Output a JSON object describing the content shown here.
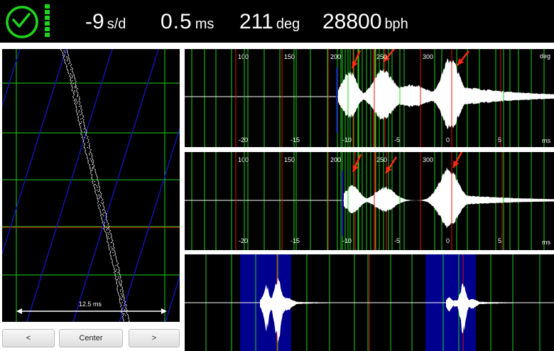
{
  "readouts": {
    "rate": {
      "value": "-9",
      "unit": "s/d"
    },
    "beat_error": {
      "value": "0.5",
      "unit": "ms"
    },
    "amplitude": {
      "value": "211",
      "unit": "deg"
    },
    "beat_rate": {
      "value": "28800",
      "unit": "bph"
    }
  },
  "colors": {
    "grid": "#1ed51e",
    "marker": "#e01010",
    "trace_line": "#1515c8",
    "highlight": "#00008f",
    "arrow": "#ff2a10"
  },
  "icons": {
    "logo": "clock-icon",
    "indicator": "signal-indicator-icon"
  },
  "timegrapher": {
    "scale_label": "12.5 ms"
  },
  "scope_top": {
    "deg_ticks": [
      {
        "v": 100,
        "t": "100"
      },
      {
        "v": 150,
        "t": "150"
      },
      {
        "v": 200,
        "t": "200"
      },
      {
        "v": 250,
        "t": "250"
      },
      {
        "v": 300,
        "t": "300"
      }
    ],
    "ms_ticks": [
      {
        "v": -20,
        "t": "-20"
      },
      {
        "v": -15,
        "t": "-15"
      },
      {
        "v": -10,
        "t": "-10"
      },
      {
        "v": -5,
        "t": "-5"
      },
      {
        "v": 0,
        "t": "0"
      },
      {
        "v": 5,
        "t": "5"
      }
    ],
    "deg_unit": "deg",
    "ms_unit": "ms"
  },
  "scope_mid": {
    "deg_ticks": [
      {
        "v": 100,
        "t": "100"
      },
      {
        "v": 150,
        "t": "150"
      },
      {
        "v": 200,
        "t": "200"
      },
      {
        "v": 250,
        "t": "250"
      },
      {
        "v": 300,
        "t": "300"
      }
    ],
    "ms_ticks": [
      {
        "v": -20,
        "t": "-20"
      },
      {
        "v": -15,
        "t": "-15"
      },
      {
        "v": -10,
        "t": "-10"
      },
      {
        "v": -5,
        "t": "-5"
      },
      {
        "v": 0,
        "t": "0"
      },
      {
        "v": 5,
        "t": "5"
      }
    ],
    "ms_unit": "ms"
  },
  "buttons": {
    "prev": "<",
    "center": "Center",
    "next": ">"
  }
}
